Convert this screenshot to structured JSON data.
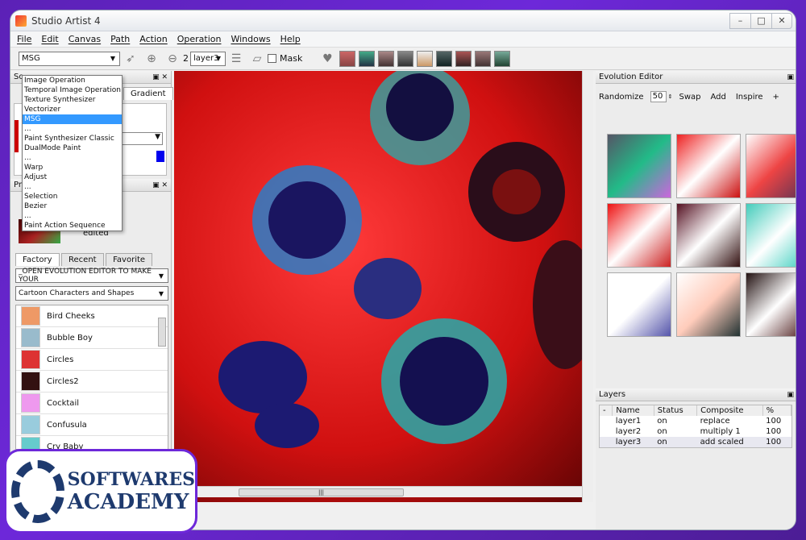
{
  "window": {
    "title": "Studio Artist 4"
  },
  "menu": [
    "File",
    "Edit",
    "Canvas",
    "Path",
    "Action",
    "Operation",
    "Windows",
    "Help"
  ],
  "toolbar": {
    "op_combo": "MSG",
    "zoom_level": "2",
    "layer_combo": "layer3",
    "mask_label": "Mask"
  },
  "op_dropdown": [
    "Image Operation",
    "Temporal Image Operation",
    "Texture Synthesizer",
    "Vectorizer",
    "MSG",
    "...",
    "Paint Synthesizer Classic",
    "DualMode Paint",
    "...",
    "Warp",
    "Adjust",
    "...",
    "Selection",
    "Bezier",
    "...",
    "Paint Action Sequence"
  ],
  "left": {
    "gradient_tab": "Gradient",
    "status": "edited",
    "tabs": [
      "Factory",
      "Recent",
      "Favorite"
    ],
    "evolution_select": "_OPEN EVOLUTION EDITOR TO MAKE YOUR",
    "category_select": "Cartoon Characters and Shapes",
    "presets": [
      "Bird Cheeks",
      "Bubble Boy",
      "Circles",
      "Circles2",
      "Cocktail",
      "Confusula",
      "Cry Baby"
    ]
  },
  "evo": {
    "title": "Evolution Editor",
    "randomize": "Randomize",
    "value": "50",
    "swap": "Swap",
    "add": "Add",
    "inspire": "Inspire",
    "plus": "+"
  },
  "layers": {
    "title": "Layers",
    "headers": [
      "-",
      "Name",
      "Status",
      "Composite",
      "%"
    ],
    "rows": [
      {
        "name": "layer1",
        "status": "on",
        "composite": "replace",
        "pct": "100"
      },
      {
        "name": "layer2",
        "status": "on",
        "composite": "multiply 1",
        "pct": "100"
      },
      {
        "name": "layer3",
        "status": "on",
        "composite": "add scaled",
        "pct": "100"
      }
    ]
  },
  "logo": {
    "line1": "SOFTWARES",
    "line2": "ACADEMY"
  }
}
